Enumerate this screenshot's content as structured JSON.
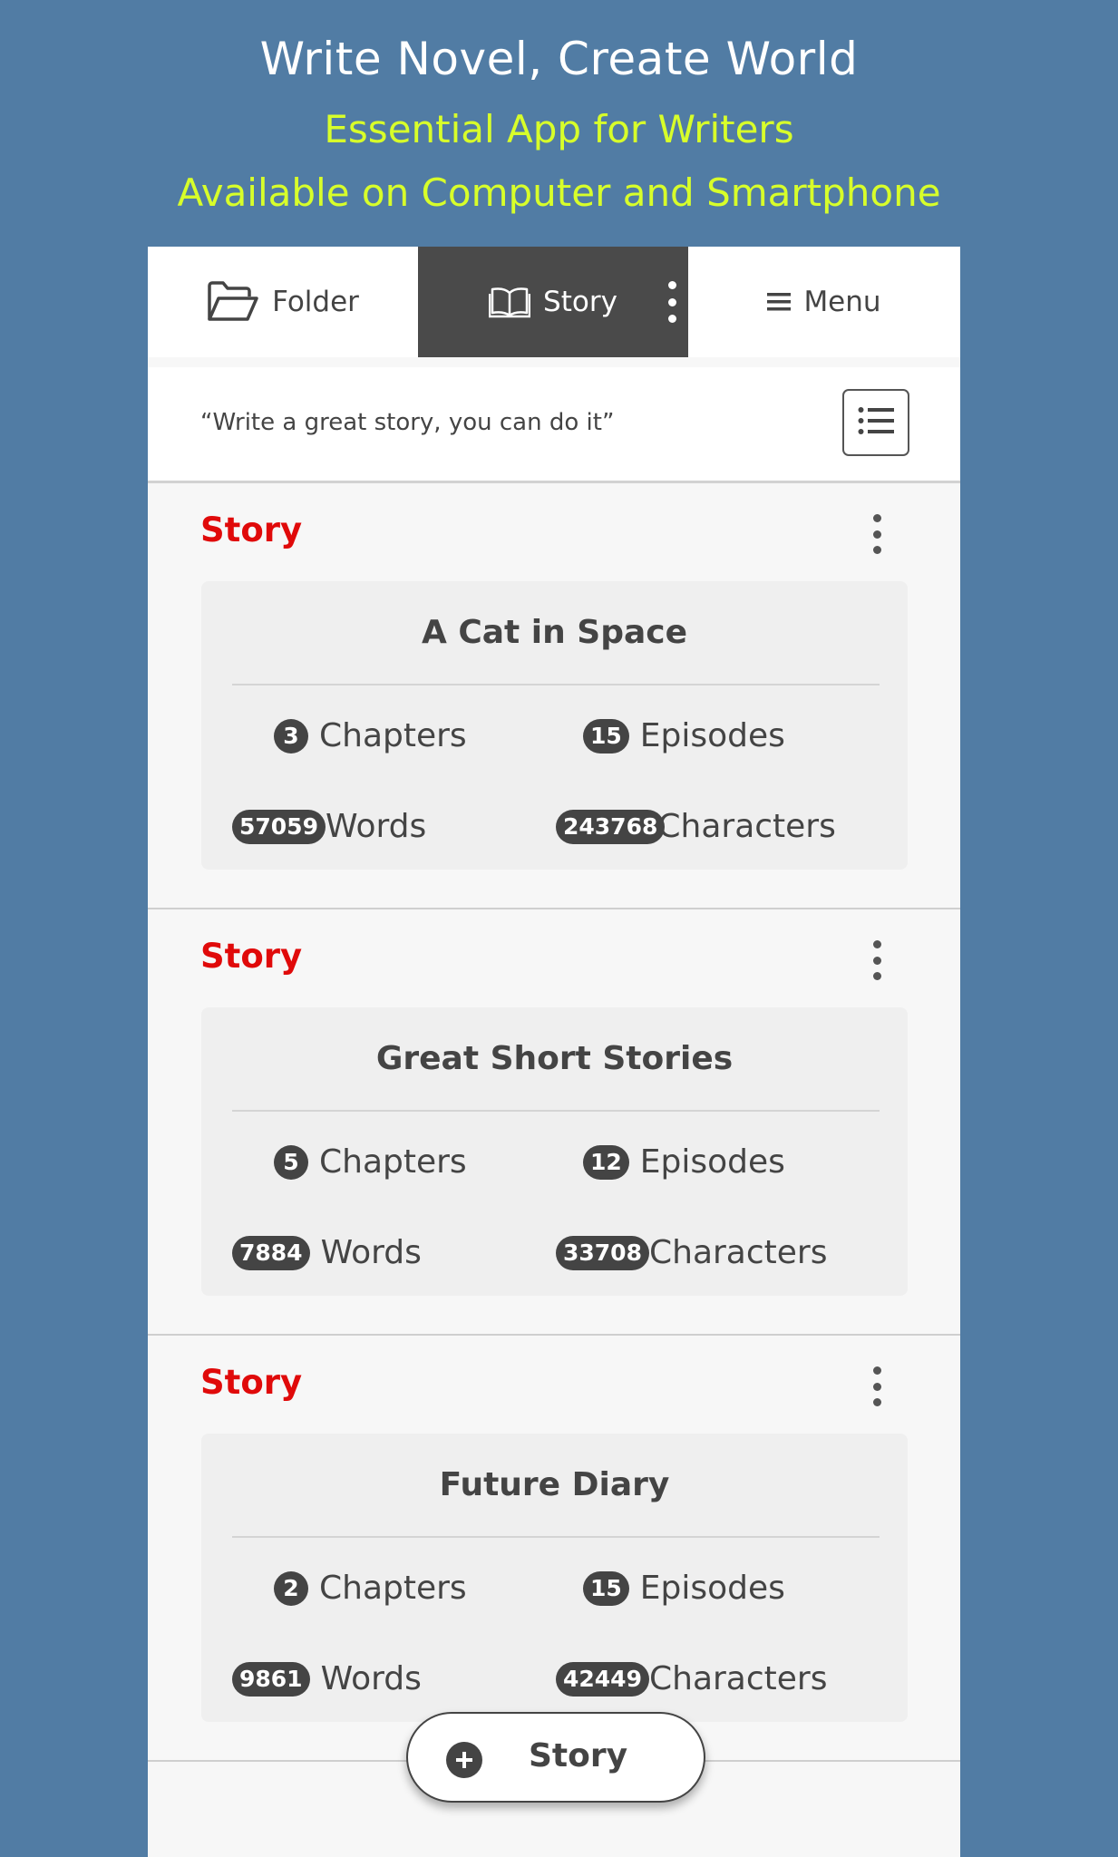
{
  "promo": {
    "title": "Write Novel, Create World",
    "subtitle_1": "Essential App for Writers",
    "subtitle_2": "Available on Computer and Smartphone"
  },
  "colors": {
    "background": "#517ca4",
    "accent_yellow": "#d8ff2a",
    "section_label": "#e00a0a",
    "active_tab": "#4a4a4a",
    "badge": "#444444"
  },
  "tabs": [
    {
      "label": "Folder",
      "icon": "folder-open-icon",
      "active": false
    },
    {
      "label": "Story",
      "icon": "book-open-icon",
      "active": true
    },
    {
      "label": "Menu",
      "icon": "hamburger-icon",
      "active": false
    }
  ],
  "quote": {
    "text": "“Write a great story, you can do it”",
    "list_button_icon": "list-icon"
  },
  "stories": [
    {
      "section_label": "Story",
      "title": "A Cat in Space",
      "chapters": "3",
      "chapters_label": "Chapters",
      "episodes": "15",
      "episodes_label": "Episodes",
      "words": "57059",
      "words_label": "Words",
      "characters": "243768",
      "characters_label": "Characters"
    },
    {
      "section_label": "Story",
      "title": "Great Short Stories",
      "chapters": "5",
      "chapters_label": "Chapters",
      "episodes": "12",
      "episodes_label": "Episodes",
      "words": "7884",
      "words_label": "Words",
      "characters": "33708",
      "characters_label": "Characters"
    },
    {
      "section_label": "Story",
      "title": "Future Diary",
      "chapters": "2",
      "chapters_label": "Chapters",
      "episodes": "15",
      "episodes_label": "Episodes",
      "words": "9861",
      "words_label": "Words",
      "characters": "42449",
      "characters_label": "Characters"
    }
  ],
  "fab": {
    "label": "Story",
    "icon": "plus-circle-icon"
  }
}
